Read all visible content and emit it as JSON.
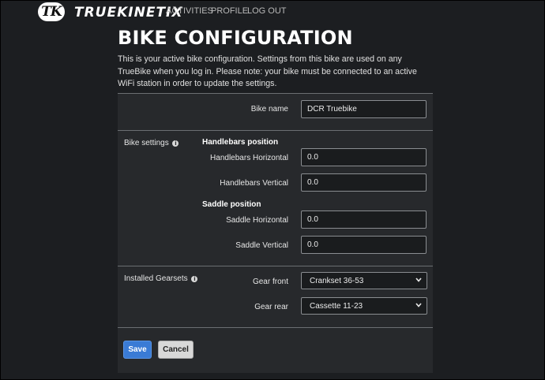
{
  "brand": {
    "logo_mark": "TK",
    "name": "TRUEKINETIX"
  },
  "nav": {
    "links": [
      "ACTIVITIES",
      "PROFILE",
      "LOG OUT"
    ]
  },
  "page": {
    "title": "BIKE CONFIGURATION",
    "intro": "This is your active bike configuration. Settings from this bike are used on any TrueBike when you log in. Please note: your bike must be connected to an active WiFi station in order to update the settings."
  },
  "form": {
    "bike_name": {
      "label": "Bike name",
      "value": "DCR Truebike"
    },
    "bike_settings": {
      "label": "Bike settings",
      "handlebars": {
        "heading": "Handlebars position",
        "horizontal": {
          "label": "Handlebars Horizontal",
          "value": "0.0"
        },
        "vertical": {
          "label": "Handlebars Vertical",
          "value": "0.0"
        }
      },
      "saddle": {
        "heading": "Saddle position",
        "horizontal": {
          "label": "Saddle Horizontal",
          "value": "0.0"
        },
        "vertical": {
          "label": "Saddle Vertical",
          "value": "0.0"
        }
      }
    },
    "gearsets": {
      "label": "Installed Gearsets",
      "front": {
        "label": "Gear front",
        "selected": "Crankset 36-53"
      },
      "rear": {
        "label": "Gear rear",
        "selected": "Cassette 11-23"
      }
    }
  },
  "actions": {
    "save": "Save",
    "cancel": "Cancel"
  },
  "colors": {
    "background": "#1c1e21",
    "panel": "#27292c",
    "primary": "#3a7bd5"
  }
}
